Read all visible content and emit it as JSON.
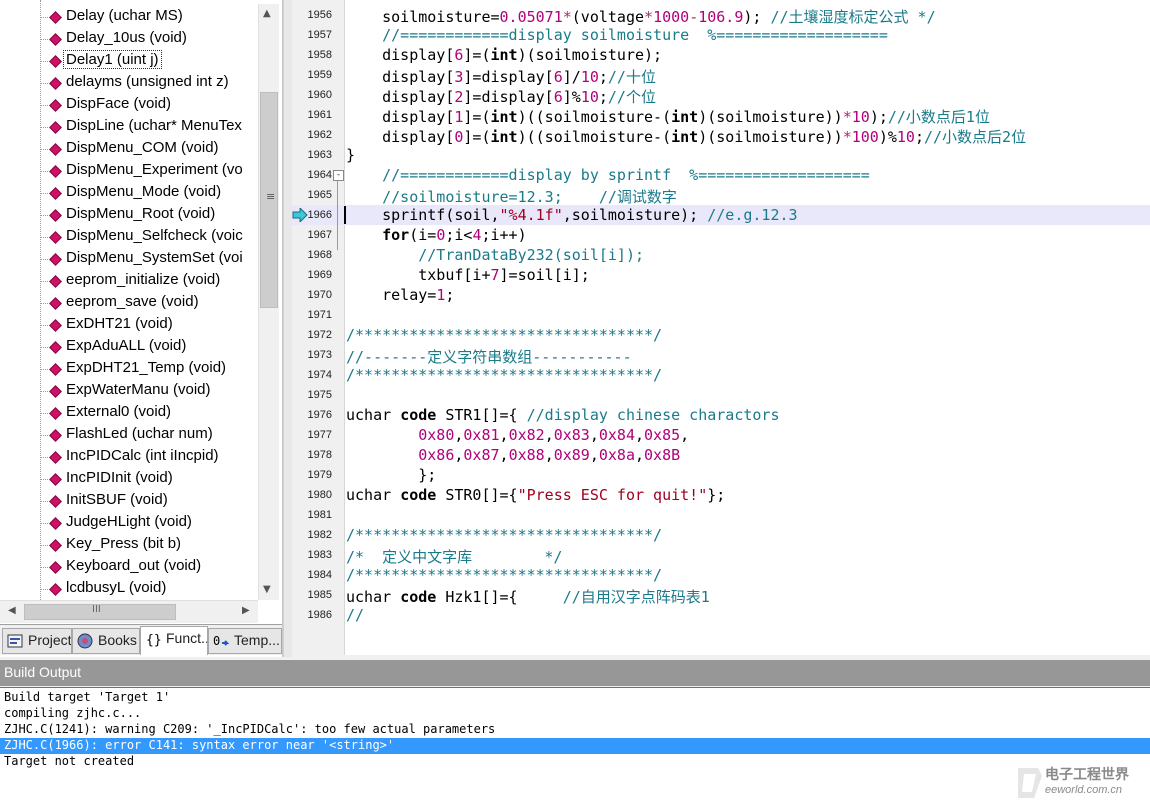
{
  "function_panel": {
    "items": [
      {
        "label": "Delay (uchar MS)"
      },
      {
        "label": "Delay_10us (void)"
      },
      {
        "label": "Delay1 (uint j)",
        "selected": true
      },
      {
        "label": "delayms (unsigned int z)"
      },
      {
        "label": "DispFace (void)"
      },
      {
        "label": "DispLine (uchar* MenuTex"
      },
      {
        "label": "DispMenu_COM (void)"
      },
      {
        "label": "DispMenu_Experiment (vo"
      },
      {
        "label": "DispMenu_Mode (void)"
      },
      {
        "label": "DispMenu_Root (void)"
      },
      {
        "label": "DispMenu_Selfcheck (voic"
      },
      {
        "label": "DispMenu_SystemSet (voi"
      },
      {
        "label": "eeprom_initialize (void)"
      },
      {
        "label": "eeprom_save (void)"
      },
      {
        "label": "ExDHT21 (void)"
      },
      {
        "label": "ExpAduALL (void)"
      },
      {
        "label": "ExpDHT21_Temp (void)"
      },
      {
        "label": "ExpWaterManu (void)"
      },
      {
        "label": "External0 (void)"
      },
      {
        "label": "FlashLed (uchar num)"
      },
      {
        "label": "IncPIDCalc (int iIncpid)"
      },
      {
        "label": "IncPIDInit (void)"
      },
      {
        "label": "InitSBUF (void)"
      },
      {
        "label": "JudgeHLight (void)"
      },
      {
        "label": "Key_Press (bit b)"
      },
      {
        "label": "Keyboard_out (void)"
      },
      {
        "label": "lcdbusyL (void)"
      }
    ],
    "hscroll_grip": "III"
  },
  "tabs": [
    {
      "label": "Project",
      "icon": "project-icon"
    },
    {
      "label": "Books",
      "icon": "books-icon"
    },
    {
      "label": "Funct...",
      "icon": "functions-icon",
      "active": true
    },
    {
      "label": "Temp...",
      "icon": "templates-icon"
    }
  ],
  "editor": {
    "current_line": 1966,
    "lines": [
      {
        "no": "1956",
        "tokens": [
          [
            "",
            "    soilmoisture="
          ],
          [
            "num",
            "0.05071"
          ],
          [
            "op",
            "*"
          ],
          [
            "",
            "(voltage"
          ],
          [
            "op",
            "*"
          ],
          [
            "num",
            "1000"
          ],
          [
            "op",
            "-"
          ],
          [
            "num",
            "106.9"
          ],
          [
            "",
            "); "
          ],
          [
            "cm",
            "//土壤湿度标定公式 */"
          ]
        ]
      },
      {
        "no": "1957",
        "tokens": [
          [
            "cm",
            "    //============display soilmoisture  %==================="
          ]
        ]
      },
      {
        "no": "1958",
        "tokens": [
          [
            "",
            "    display["
          ],
          [
            "num",
            "6"
          ],
          [
            "",
            "]=("
          ],
          [
            "kw",
            "int"
          ],
          [
            "",
            ")(soilmoisture);"
          ]
        ]
      },
      {
        "no": "1959",
        "tokens": [
          [
            "",
            "    display["
          ],
          [
            "num",
            "3"
          ],
          [
            "",
            "]=display["
          ],
          [
            "num",
            "6"
          ],
          [
            "",
            "]/"
          ],
          [
            "num",
            "10"
          ],
          [
            "",
            ";"
          ],
          [
            "cm",
            "//十位"
          ]
        ]
      },
      {
        "no": "1960",
        "tokens": [
          [
            "",
            "    display["
          ],
          [
            "num",
            "2"
          ],
          [
            "",
            "]=display["
          ],
          [
            "num",
            "6"
          ],
          [
            "",
            "]%"
          ],
          [
            "num",
            "10"
          ],
          [
            "",
            ";"
          ],
          [
            "cm",
            "//个位"
          ]
        ]
      },
      {
        "no": "1961",
        "tokens": [
          [
            "",
            "    display["
          ],
          [
            "num",
            "1"
          ],
          [
            "",
            "]=("
          ],
          [
            "kw",
            "int"
          ],
          [
            "",
            ")((soilmoisture-("
          ],
          [
            "kw",
            "int"
          ],
          [
            "",
            ")(soilmoisture))"
          ],
          [
            "op",
            "*"
          ],
          [
            "num",
            "10"
          ],
          [
            "",
            ");"
          ],
          [
            "cm",
            "//小数点后1位"
          ]
        ]
      },
      {
        "no": "1962",
        "tokens": [
          [
            "",
            "    display["
          ],
          [
            "num",
            "0"
          ],
          [
            "",
            "]=("
          ],
          [
            "kw",
            "int"
          ],
          [
            "",
            ")((soilmoisture-("
          ],
          [
            "kw",
            "int"
          ],
          [
            "",
            ")(soilmoisture))"
          ],
          [
            "op",
            "*"
          ],
          [
            "num",
            "100"
          ],
          [
            "",
            ")%"
          ],
          [
            "num",
            "10"
          ],
          [
            "",
            ";"
          ],
          [
            "cm",
            "//小数点后2位"
          ]
        ]
      },
      {
        "no": "1963",
        "tokens": [
          [
            "",
            "}"
          ]
        ]
      },
      {
        "no": "1964",
        "tokens": [
          [
            "cm",
            "    //============display by sprintf  %==================="
          ]
        ],
        "fold": "-"
      },
      {
        "no": "1965",
        "tokens": [
          [
            "cm",
            "    //soilmoisture=12.3;    //调试数字"
          ]
        ]
      },
      {
        "no": "1966",
        "tokens": [
          [
            "",
            "    sprintf(soil,"
          ],
          [
            "str",
            "\"%4.1f\""
          ],
          [
            "",
            ",soilmoisture); "
          ],
          [
            "cm",
            "//e.g.12.3"
          ]
        ]
      },
      {
        "no": "1967",
        "tokens": [
          [
            "",
            "    "
          ],
          [
            "kw",
            "for"
          ],
          [
            "",
            "(i="
          ],
          [
            "num",
            "0"
          ],
          [
            "",
            ";i<"
          ],
          [
            "num",
            "4"
          ],
          [
            "",
            ";i++)"
          ]
        ]
      },
      {
        "no": "1968",
        "tokens": [
          [
            "cm",
            "        //TranDataBy232(soil[i]);"
          ]
        ]
      },
      {
        "no": "1969",
        "tokens": [
          [
            "",
            "        txbuf[i+"
          ],
          [
            "num",
            "7"
          ],
          [
            "",
            "]=soil[i];"
          ]
        ]
      },
      {
        "no": "1970",
        "tokens": [
          [
            "",
            "    relay="
          ],
          [
            "num",
            "1"
          ],
          [
            "",
            ";"
          ]
        ]
      },
      {
        "no": "1971",
        "tokens": []
      },
      {
        "no": "1972",
        "tokens": [
          [
            "cm",
            "/*********************************/"
          ]
        ]
      },
      {
        "no": "1973",
        "tokens": [
          [
            "cm",
            "//-------定义字符串数组-----------"
          ]
        ]
      },
      {
        "no": "1974",
        "tokens": [
          [
            "cm",
            "/*********************************/"
          ]
        ]
      },
      {
        "no": "1975",
        "tokens": []
      },
      {
        "no": "1976",
        "tokens": [
          [
            "",
            "uchar "
          ],
          [
            "kw",
            "code"
          ],
          [
            "",
            " STR1[]={ "
          ],
          [
            "cm",
            "//display chinese charactors"
          ]
        ]
      },
      {
        "no": "1977",
        "tokens": [
          [
            "",
            "        "
          ],
          [
            "num",
            "0x80"
          ],
          [
            "",
            ","
          ],
          [
            "num",
            "0x81"
          ],
          [
            "",
            ","
          ],
          [
            "num",
            "0x82"
          ],
          [
            "",
            ","
          ],
          [
            "num",
            "0x83"
          ],
          [
            "",
            ","
          ],
          [
            "num",
            "0x84"
          ],
          [
            "",
            ","
          ],
          [
            "num",
            "0x85"
          ],
          [
            "",
            ","
          ]
        ]
      },
      {
        "no": "1978",
        "tokens": [
          [
            "",
            "        "
          ],
          [
            "num",
            "0x86"
          ],
          [
            "",
            ","
          ],
          [
            "num",
            "0x87"
          ],
          [
            "",
            ","
          ],
          [
            "num",
            "0x88"
          ],
          [
            "",
            ","
          ],
          [
            "num",
            "0x89"
          ],
          [
            "",
            ","
          ],
          [
            "num",
            "0x8a"
          ],
          [
            "",
            ","
          ],
          [
            "num",
            "0x8B"
          ]
        ]
      },
      {
        "no": "1979",
        "tokens": [
          [
            "",
            "        };"
          ]
        ]
      },
      {
        "no": "1980",
        "tokens": [
          [
            "",
            "uchar "
          ],
          [
            "kw",
            "code"
          ],
          [
            "",
            " STR0[]={"
          ],
          [
            "str",
            "\"Press ESC for quit!\""
          ],
          [
            "",
            "};"
          ]
        ]
      },
      {
        "no": "1981",
        "tokens": []
      },
      {
        "no": "1982",
        "tokens": [
          [
            "cm",
            "/*********************************/"
          ]
        ]
      },
      {
        "no": "1983",
        "tokens": [
          [
            "cm",
            "/*  定义中文字库        */"
          ]
        ]
      },
      {
        "no": "1984",
        "tokens": [
          [
            "cm",
            "/*********************************/"
          ]
        ]
      },
      {
        "no": "1985",
        "tokens": [
          [
            "",
            "uchar "
          ],
          [
            "kw",
            "code"
          ],
          [
            "",
            " Hzk1[]={     "
          ],
          [
            "cm",
            "//自用汉字点阵码表1"
          ]
        ]
      },
      {
        "no": "1986",
        "tokens": [
          [
            "cm",
            "//"
          ]
        ]
      }
    ]
  },
  "build_output": {
    "title": "Build Output",
    "lines": [
      {
        "text": "Build target 'Target 1'"
      },
      {
        "text": "compiling zjhc.c..."
      },
      {
        "text": "ZJHC.C(1241): warning C209: '_IncPIDCalc': too few actual parameters"
      },
      {
        "text": "ZJHC.C(1966): error C141: syntax error near '<string>'",
        "highlighted": true
      },
      {
        "text": "Target not created"
      }
    ]
  },
  "watermark": {
    "name": "电子工程世界",
    "url": "eeworld.com.cn"
  },
  "colors": {
    "keyword": "#000000",
    "number": "#b0007a",
    "string": "#a00020",
    "comment": "#1a7a8a",
    "selection": "#3399ff",
    "current_line": "#e8e8fa",
    "function_marker": "#cc1166"
  }
}
